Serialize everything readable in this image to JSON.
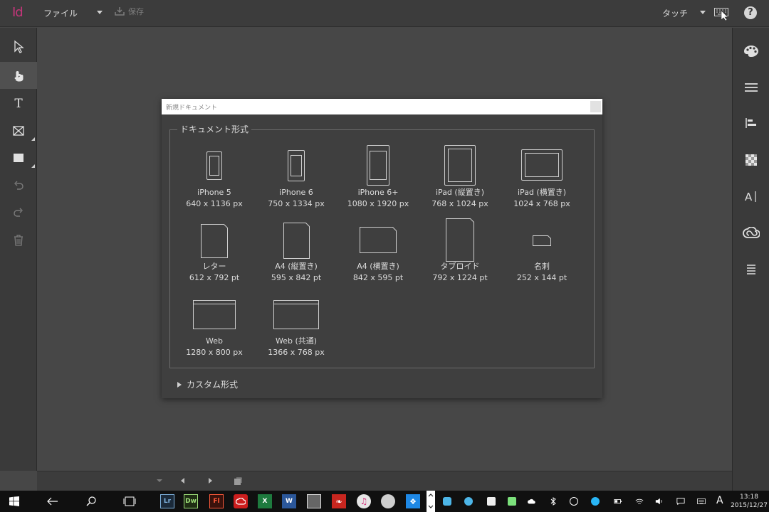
{
  "app": {
    "logo": "Id",
    "file_menu": "ファイル",
    "save_label": "保存",
    "touch_mode": "タッチ"
  },
  "dialog": {
    "title": "新規ドキュメント",
    "section_title": "ドキュメント形式",
    "custom_label": "カスタム形式",
    "presets": [
      {
        "name": "iPhone 5",
        "dims": "640 x 1136 px"
      },
      {
        "name": "iPhone 6",
        "dims": "750 x 1334 px"
      },
      {
        "name": "iPhone 6+",
        "dims": "1080 x 1920 px"
      },
      {
        "name": "iPad (縦置き)",
        "dims": "768 x 1024 px"
      },
      {
        "name": "iPad (横置き)",
        "dims": "1024 x 768 px"
      },
      {
        "name": "レター",
        "dims": "612 x 792 pt"
      },
      {
        "name": "A4 (縦置き)",
        "dims": "595 x 842 pt"
      },
      {
        "name": "A4 (横置き)",
        "dims": "842 x 595 pt"
      },
      {
        "name": "タブロイド",
        "dims": "792 x 1224 pt"
      },
      {
        "name": "名刺",
        "dims": "252 x 144 pt"
      },
      {
        "name": "Web",
        "dims": "1280 x 800 px"
      },
      {
        "name": "Web (共通)",
        "dims": "1366 x 768 px"
      }
    ]
  },
  "taskbar": {
    "apps": [
      {
        "label": "Lr",
        "color": "#7fb3e0",
        "bg": "#1b2a3a"
      },
      {
        "label": "Dw",
        "color": "#9fe07a",
        "bg": "#1f2d14"
      },
      {
        "label": "Fl",
        "color": "#ff5a3a",
        "bg": "#3a120c"
      },
      {
        "label": "",
        "color": "#ff2a2a",
        "bg": "#cc1e1e"
      },
      {
        "label": "X",
        "color": "#ffffff",
        "bg": "#1e7a3e"
      },
      {
        "label": "W",
        "color": "#ffffff",
        "bg": "#2b579a"
      },
      {
        "label": "",
        "color": "#dddddd",
        "bg": "#666666"
      },
      {
        "label": "",
        "color": "#ffffff",
        "bg": "#c8261f"
      },
      {
        "label": "",
        "color": "#ffffff",
        "bg": "#e6e6e6"
      },
      {
        "label": "",
        "color": "#ffffff",
        "bg": "#cfcfcf"
      },
      {
        "label": "",
        "color": "#ffffff",
        "bg": "#1e88e5"
      }
    ],
    "ime": "A",
    "time": "13:18",
    "date": "2015/12/27"
  }
}
